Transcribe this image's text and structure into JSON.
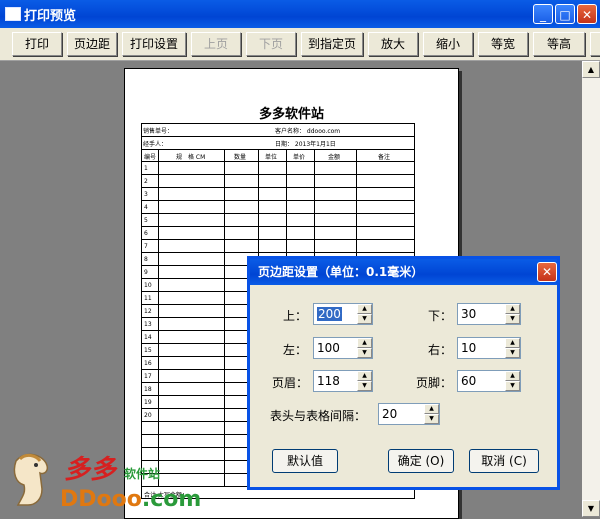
{
  "window": {
    "title": "打印预览",
    "minimize_label": "_",
    "maximize_label": "□",
    "close_label": "✕"
  },
  "toolbar": {
    "buttons": [
      {
        "label": "打印",
        "enabled": true
      },
      {
        "label": "页边距",
        "enabled": true
      },
      {
        "label": "打印设置",
        "enabled": true
      },
      {
        "label": "上页",
        "enabled": false
      },
      {
        "label": "下页",
        "enabled": false
      },
      {
        "label": "到指定页",
        "enabled": true
      },
      {
        "label": "放大",
        "enabled": true
      },
      {
        "label": "缩小",
        "enabled": true
      },
      {
        "label": "等宽",
        "enabled": true
      },
      {
        "label": "等高",
        "enabled": true
      }
    ]
  },
  "preview": {
    "title": "多多软件站",
    "info": {
      "left1": "销售单号：",
      "right1": "客户名称： ddooo.com",
      "left2": "经手人：",
      "right2": "日期： 2013年1月1日"
    },
    "columns": [
      "编号",
      "规　格 CM",
      "数量",
      "单位",
      "单价",
      "金额",
      "备注"
    ],
    "rows": [
      "1",
      "2",
      "3",
      "4",
      "5",
      "6",
      "7",
      "8",
      "9",
      "10",
      "11",
      "12",
      "13",
      "14",
      "15",
      "16",
      "17",
      "18",
      "19",
      "20"
    ],
    "footer": "合计 大写金额："
  },
  "watermark": {
    "cn_text": "多多",
    "cn_sub": "软件站",
    "en_main": "DDooo",
    "en_suffix": ".com"
  },
  "dialog": {
    "title": "页边距设置（单位：0.1毫米）",
    "close_label": "✕",
    "fields": {
      "top": {
        "label": "上：",
        "value": "200"
      },
      "bottom": {
        "label": "下：",
        "value": "30"
      },
      "left": {
        "label": "左：",
        "value": "100"
      },
      "right": {
        "label": "右：",
        "value": "10"
      },
      "header": {
        "label": "页眉：",
        "value": "118"
      },
      "footer": {
        "label": "页脚：",
        "value": "60"
      },
      "gap": {
        "label": "表头与表格间隔：",
        "value": "20"
      }
    },
    "buttons": {
      "default": "默认值",
      "ok": "确定 (O)",
      "cancel": "取消 (C)"
    }
  }
}
